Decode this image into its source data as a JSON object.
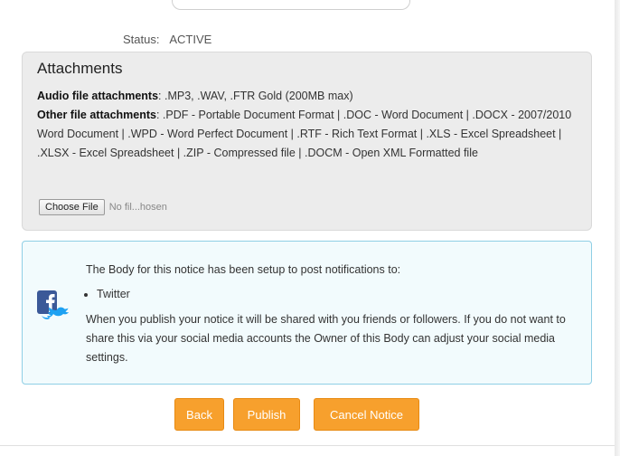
{
  "status": {
    "label": "Status:",
    "value": "ACTIVE"
  },
  "attachments": {
    "title": "Attachments",
    "audio_label": "Audio file attachments",
    "audio_formats": ": .MP3, .WAV, .FTR Gold (200MB max)",
    "other_label": "Other file attachments",
    "other_formats": ": .PDF - Portable Document Format | .DOC - Word Document | .DOCX - 2007/2010 Word Document | .WPD - Word Perfect Document | .RTF - Rich Text Format | .XLS - Excel Spreadsheet | .XLSX - Excel Spreadsheet | .ZIP - Compressed file | .DOCM - Open XML Formatted file",
    "choose_file_label": "Choose File",
    "no_file_text": "No fil...hosen"
  },
  "social": {
    "intro": "The Body for this notice has been setup to post notifications to:",
    "platforms": [
      "Twitter"
    ],
    "description": "When you publish your notice it will be shared with you friends or followers. If you do not want to share this via your social media accounts the Owner of this Body can adjust your social media settings.",
    "icon": "facebook-twitter-icon"
  },
  "buttons": {
    "back": "Back",
    "publish": "Publish",
    "cancel": "Cancel Notice"
  },
  "colors": {
    "button_orange": "#f7a02d",
    "social_border": "#8fcfe5",
    "social_bg": "#f2fbfd",
    "attachments_bg": "#ececec",
    "facebook_blue": "#3b5998",
    "twitter_blue": "#1da1f2"
  }
}
